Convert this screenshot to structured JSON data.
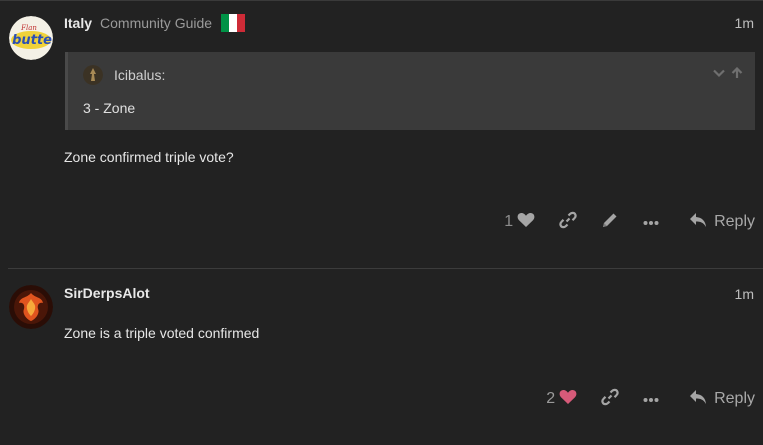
{
  "posts": [
    {
      "username": "Italy",
      "user_title": "Community Guide",
      "flag_colors": [
        "#009246",
        "#ffffff",
        "#ce2b37"
      ],
      "time": "1m",
      "quote": {
        "author": "Icibalus:",
        "text": "3 - Zone"
      },
      "body": "Zone confirmed triple vote?",
      "like_count": "1",
      "liked": false,
      "reply_label": "Reply"
    },
    {
      "username": "SirDerpsAlot",
      "time": "1m",
      "body": "Zone is a triple voted confirmed",
      "like_count": "2",
      "liked": true,
      "reply_label": "Reply"
    }
  ],
  "colors": {
    "background": "#222222",
    "liked_heart": "#d65a79",
    "icon": "#a5a5a5"
  },
  "icons": [
    "heart-icon",
    "link-icon",
    "pencil-icon",
    "more-icon",
    "reply-icon",
    "chevron-down-icon",
    "arrow-up-icon"
  ]
}
